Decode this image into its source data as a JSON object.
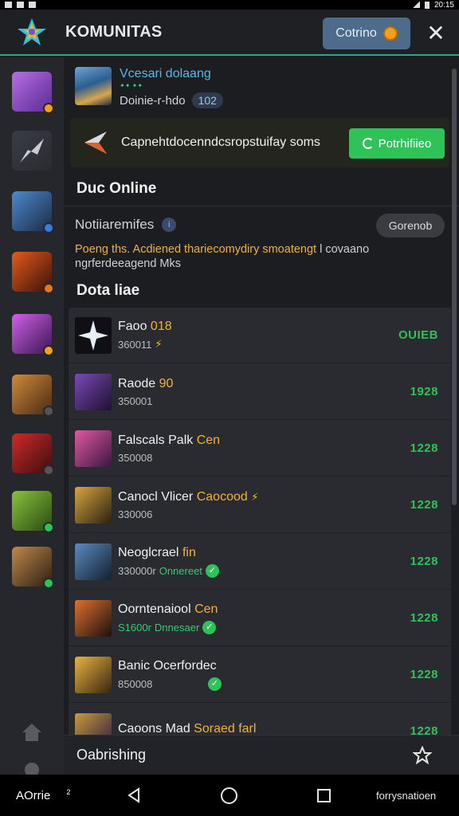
{
  "status_bar": {
    "time": "20:15"
  },
  "header": {
    "title": "KOMUNITAS",
    "button_label": "Cotrino",
    "close_symbol": "✕"
  },
  "profile": {
    "name": "Vcesari dolaang",
    "tagline": "✦✦ ✦✦",
    "meta_label": "Doinie-r-hdo",
    "level": "102"
  },
  "banner": {
    "text": "Capnehtdocenndcsropstuifay soms",
    "button_label": "Potrhifiieo"
  },
  "sections": {
    "online_title": "Duc Online",
    "list_title": "Dota liae"
  },
  "notification": {
    "heading": "Notiiaremifes",
    "button_label": "Gorenob",
    "body_highlight": "Poeng ths. Acdiened thariecomydiry smoatengt",
    "body_rest": "l covaano ngrferdeeagend Mks"
  },
  "list": {
    "rows": [
      {
        "name": "Faoo",
        "name_highlight": "018",
        "sub": "360011",
        "status": "",
        "value": "OUIEB",
        "icon": "white-star-burst",
        "mark": "bolt"
      },
      {
        "name": "Raode",
        "name_highlight": "90",
        "sub": "350001",
        "status": "",
        "value": "1928",
        "icon": "purple-knight",
        "mark": ""
      },
      {
        "name": "Falscals Palk",
        "name_highlight": "Cen",
        "sub": "350008",
        "status": "",
        "value": "1228",
        "icon": "pink-hero",
        "mark": ""
      },
      {
        "name": "Canocl Vlicer",
        "name_highlight": "Caocood",
        "sub": "330006",
        "status": "",
        "value": "1228",
        "icon": "straw-hat-hero",
        "mark": "bolt"
      },
      {
        "name": "Neoglcrael",
        "name_highlight": "fin",
        "sub": "330000r",
        "status": "Onnereet",
        "value": "1228",
        "icon": "armored-soldier",
        "mark": "check"
      },
      {
        "name": "Oorntenaiool",
        "name_highlight": "Cen",
        "sub": "S1600r",
        "status": "Dnnesaer",
        "value": "1228",
        "icon": "fire-blade",
        "mark": "check"
      },
      {
        "name": "Banic Ocerfordec",
        "name_highlight": "",
        "sub": "850008",
        "status": "",
        "value": "1228",
        "icon": "golden-warrior",
        "mark": "check"
      },
      {
        "name": "Caoons Mad",
        "name_highlight": "Soraed farl",
        "sub": "",
        "status": "",
        "value": "1228",
        "icon": "crowned-hero",
        "mark": ""
      }
    ]
  },
  "bottom_sheet": {
    "label": "Oabrishing"
  },
  "navbar": {
    "left_label": "AOrrie",
    "left_sup": "2",
    "right_label": "forrysnatioen"
  },
  "sidebar": {
    "items": [
      {
        "icon": "purple-mage-avatar",
        "badge_color": "#f0a21c"
      },
      {
        "icon": "silver-blade-avatar",
        "badge_color": ""
      },
      {
        "icon": "mech-warrior-avatar",
        "badge_color": "#3a7be0"
      },
      {
        "icon": "fire-demon-avatar",
        "badge_color": "#e07a1c"
      },
      {
        "icon": "purple-lightning-avatar",
        "badge_color": "#f0a21c"
      },
      {
        "icon": "bronze-knight-avatar",
        "badge_color": "#555"
      },
      {
        "icon": "red-assassin-avatar",
        "badge_color": "#555"
      },
      {
        "icon": "green-sniper-avatar",
        "badge_color": "#2ec259"
      },
      {
        "icon": "dark-armor-avatar",
        "badge_color": "#2ec259"
      }
    ]
  },
  "colors": {
    "accent": "#2ec259",
    "highlight": "#f0b23a",
    "header_button": "#4e6b8b"
  }
}
